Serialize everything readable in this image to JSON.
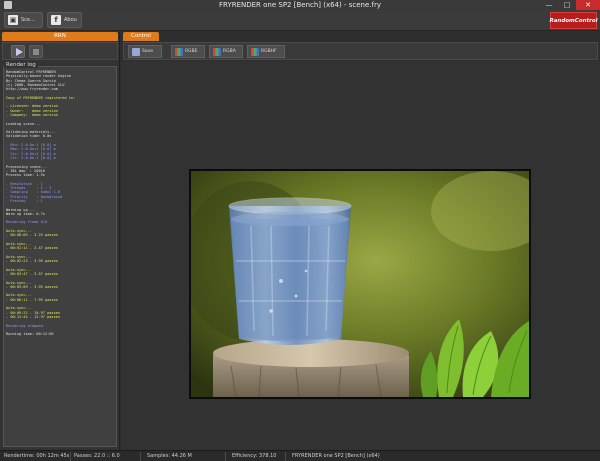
{
  "window": {
    "title": "FRYRENDER one SP2 [Bench] (x64) - scene.fry",
    "minimize": "—",
    "maximize": "□",
    "close": "✕"
  },
  "toolbar": {
    "scene_label": "Sce...",
    "about_label": "Abou",
    "brand": "RandomControl"
  },
  "left_panel": {
    "tab": "RRN",
    "log_title": "Render log",
    "log": [
      {
        "t": "RandomControl FRYRENDER",
        "c": "white"
      },
      {
        "t": "Physically-based render engine",
        "c": "white"
      },
      {
        "t": "By: Chema Guerra Garcia",
        "c": "white"
      },
      {
        "t": "(c) 2008, RandomControl SLU",
        "c": "white"
      },
      {
        "t": "http://www.fryrender.com",
        "c": "white"
      },
      {
        "t": "",
        "c": "gap"
      },
      {
        "t": "Copy of FRYRENDER registered to:",
        "c": "yellow"
      },
      {
        "t": "",
        "c": "gap"
      },
      {
        "t": "- Licensee: demo version",
        "c": "yellow"
      },
      {
        "t": "- Owner:    demo version",
        "c": "yellow"
      },
      {
        "t": "- Company:  demo version",
        "c": "yellow"
      },
      {
        "t": "",
        "c": "gap"
      },
      {
        "t": "Loading scene...",
        "c": "white"
      },
      {
        "t": "",
        "c": "gap"
      },
      {
        "t": "Validating materials...",
        "c": "white"
      },
      {
        "t": "Validation time: 0.0s",
        "c": "white"
      },
      {
        "t": "",
        "c": "gap"
      },
      {
        "t": "- Min: 2.0.0e-1 [0.0] m",
        "c": "blue"
      },
      {
        "t": "- Max: 2.0.0e+1 [0.0] m",
        "c": "blue"
      },
      {
        "t": "- Siz: 2.0.0e+1 [0.0] m",
        "c": "blue"
      },
      {
        "t": "- Ctr: 2.0.0e-1 [0.0] m",
        "c": "blue"
      },
      {
        "t": "",
        "c": "gap"
      },
      {
        "t": "Processing scene...",
        "c": "white"
      },
      {
        "t": "- IBL map  : 20016",
        "c": "white"
      },
      {
        "t": "Process time: 1.5s",
        "c": "white"
      },
      {
        "t": "",
        "c": "gap"
      },
      {
        "t": "- Resolution  : 1",
        "c": "blue"
      },
      {
        "t": "- Threads     : 2 : 2",
        "c": "blue"
      },
      {
        "t": "- Sampling    : Sobol 1.0",
        "c": "blue"
      },
      {
        "t": "- Priority    : background",
        "c": "blue"
      },
      {
        "t": "- Preview     : 1",
        "c": "blue"
      },
      {
        "t": "",
        "c": "gap"
      },
      {
        "t": "Warming up...",
        "c": "white"
      },
      {
        "t": "Warm up time: 0.7s",
        "c": "white"
      },
      {
        "t": "",
        "c": "gap"
      },
      {
        "t": "Rendering frame 0/0",
        "c": "blue"
      },
      {
        "t": "",
        "c": "gap"
      },
      {
        "t": "Auto-sync...",
        "c": "yellow"
      },
      {
        "t": "- 00:00:05 - 3.25 passes",
        "c": "yellow"
      },
      {
        "t": "",
        "c": "gap"
      },
      {
        "t": "Auto-sync...",
        "c": "yellow"
      },
      {
        "t": "- 00:01:11 - 3.47 passes",
        "c": "yellow"
      },
      {
        "t": "",
        "c": "gap"
      },
      {
        "t": "Auto-sync...",
        "c": "yellow"
      },
      {
        "t": "- 00:02:23 - 3.95 passes",
        "c": "yellow"
      },
      {
        "t": "",
        "c": "gap"
      },
      {
        "t": "Auto-sync...",
        "c": "yellow"
      },
      {
        "t": "- 00:03:47 - 3.57 passes",
        "c": "yellow"
      },
      {
        "t": "",
        "c": "gap"
      },
      {
        "t": "Auto-sync...",
        "c": "yellow"
      },
      {
        "t": "- 00:05:09 - 3.95 passes",
        "c": "yellow"
      },
      {
        "t": "",
        "c": "gap"
      },
      {
        "t": "Auto-sync...",
        "c": "yellow"
      },
      {
        "t": "- 00:06:11 - 7.95 passes",
        "c": "yellow"
      },
      {
        "t": "",
        "c": "gap"
      },
      {
        "t": "Auto-sync...",
        "c": "yellow"
      },
      {
        "t": "- 00:09:22 - 10.97 passes",
        "c": "yellow"
      },
      {
        "t": "- 00:12:45 - 12.97 passes",
        "c": "yellow"
      },
      {
        "t": "",
        "c": "gap"
      },
      {
        "t": "Rendering stopped.",
        "c": "blue"
      },
      {
        "t": "",
        "c": "gap"
      },
      {
        "t": "Running time: 00:12:56",
        "c": "white"
      }
    ]
  },
  "right_panel": {
    "tab": "Control",
    "buttons": {
      "save": "Save",
      "rgbe": "RGBE",
      "rgba": "RGBA",
      "rgbhf": "RGBHF"
    }
  },
  "status": {
    "rendertime": "Rendertime: 00h 12m 45s",
    "passes": "Passes: 22.0 :: 6.0",
    "samples": "Samples: 44.26 M",
    "efficiency": "Efficiency: 378.10",
    "product": "FRYRENDER one SP2 [Bench] (x64)"
  },
  "colors": {
    "accent": "#e07b1c",
    "brand": "#b81d1d",
    "log_yellow": "#e8e45c",
    "log_blue": "#8f9bf5"
  }
}
